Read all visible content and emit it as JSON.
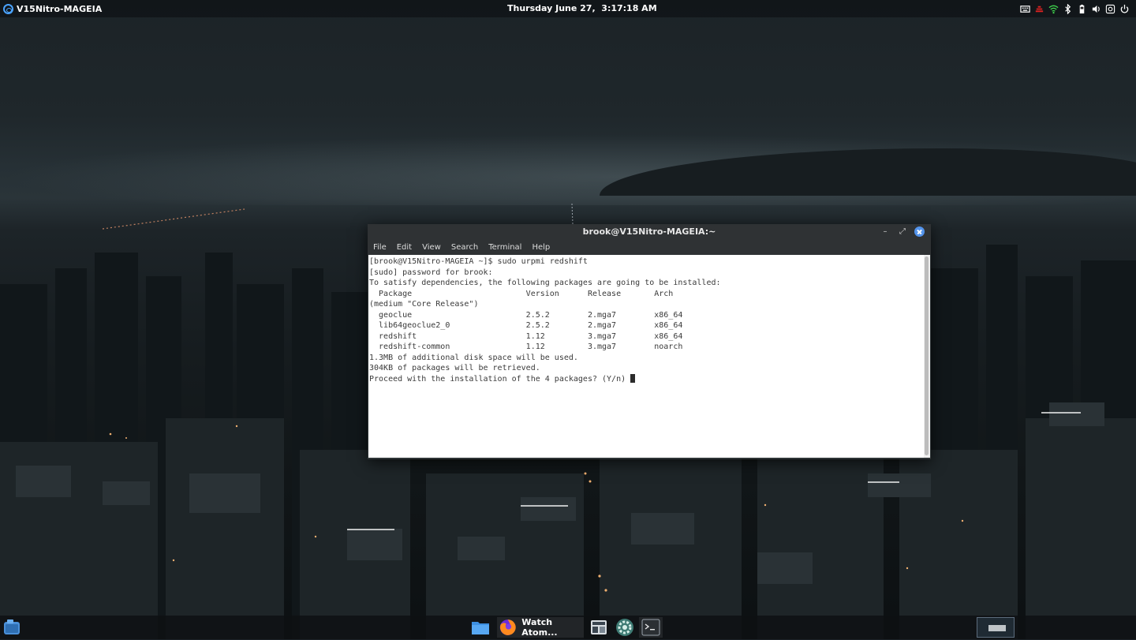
{
  "top_panel": {
    "app_menu_label": "V15Nitro-MAGEIA",
    "clock": "Thursday June 27,  3:17:18 AM",
    "tray_icons": [
      "keyboard-icon",
      "network-warning-icon",
      "wifi-icon",
      "bluetooth-icon",
      "battery-icon",
      "volume-icon",
      "screenshot-icon",
      "power-icon"
    ]
  },
  "terminal": {
    "title": "brook@V15Nitro-MAGEIA:~",
    "menu": [
      "File",
      "Edit",
      "View",
      "Search",
      "Terminal",
      "Help"
    ],
    "lines": [
      "[brook@V15Nitro-MAGEIA ~]$ sudo urpmi redshift",
      "[sudo] password for brook:",
      "To satisfy dependencies, the following packages are going to be installed:",
      "  Package                        Version      Release       Arch",
      "(medium \"Core Release\")",
      "  geoclue                        2.5.2        2.mga7        x86_64",
      "  lib64geoclue2_0                2.5.2        2.mga7        x86_64",
      "  redshift                       1.12         3.mga7        x86_64",
      "  redshift-common                1.12         3.mga7        noarch",
      "1.3MB of additional disk space will be used.",
      "304KB of packages will be retrieved."
    ],
    "prompt": "Proceed with the installation of the 4 packages? (Y/n) "
  },
  "taskbar": {
    "tasks": [
      {
        "icon": "file-manager-icon",
        "label": ""
      },
      {
        "icon": "firefox-icon",
        "label": "Watch Atom..."
      },
      {
        "icon": "system-monitor-icon",
        "label": ""
      },
      {
        "icon": "settings-icon",
        "label": ""
      },
      {
        "icon": "terminal-icon",
        "label": ""
      }
    ]
  },
  "colors": {
    "accent": "#5394ec",
    "terminal_bg": "#ffffff",
    "terminal_fg": "#3a3a3a",
    "panel_text": "#ffffff"
  }
}
